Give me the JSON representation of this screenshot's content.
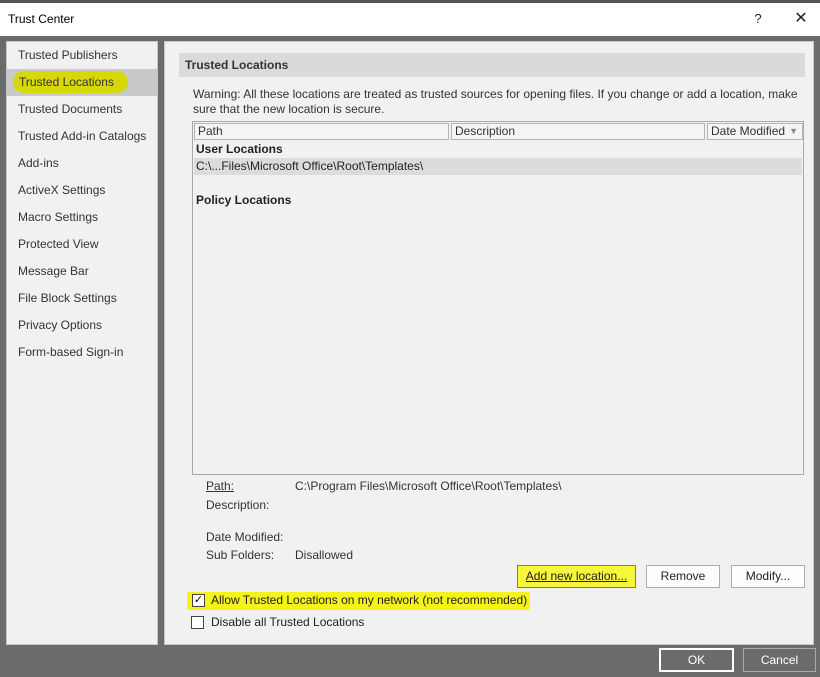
{
  "window": {
    "title": "Trust Center",
    "help_glyph": "?",
    "close_glyph": "✕"
  },
  "sidebar": {
    "items": [
      {
        "label": "Trusted Publishers"
      },
      {
        "label": "Trusted Locations"
      },
      {
        "label": "Trusted Documents"
      },
      {
        "label": "Trusted Add-in Catalogs"
      },
      {
        "label": "Add-ins"
      },
      {
        "label": "ActiveX Settings"
      },
      {
        "label": "Macro Settings"
      },
      {
        "label": "Protected View"
      },
      {
        "label": "Message Bar"
      },
      {
        "label": "File Block Settings"
      },
      {
        "label": "Privacy Options"
      },
      {
        "label": "Form-based Sign-in"
      }
    ],
    "selected_label": "Trusted Locations"
  },
  "main": {
    "section_title": "Trusted Locations",
    "warning": "Warning: All these locations are treated as trusted sources for opening files.  If you change or add a location, make sure that the new location is secure.",
    "list": {
      "columns": [
        "Path",
        "Description",
        "Date Modified"
      ],
      "user_locations_label": "User Locations",
      "rows": [
        {
          "path": "C:\\...Files\\Microsoft Office\\Root\\Templates\\"
        }
      ],
      "policy_locations_label": "Policy Locations"
    },
    "details": {
      "path_label": "Path:",
      "path_value": "C:\\Program Files\\Microsoft Office\\Root\\Templates\\",
      "description_label": "Description:",
      "date_modified_label": "Date Modified:",
      "sub_folders_label": "Sub Folders:",
      "sub_folders_value": "Disallowed"
    },
    "buttons": {
      "add": "Add new location...",
      "remove": "Remove",
      "modify": "Modify..."
    },
    "checkboxes": {
      "allow_network": {
        "label": "Allow Trusted Locations on my network (not recommended)",
        "checked": true
      },
      "disable_all": {
        "label": "Disable all Trusted Locations",
        "checked": false
      }
    }
  },
  "footer": {
    "ok": "OK",
    "cancel": "Cancel"
  },
  "colors": {
    "highlight": "#f4f41a",
    "selection": "#c9c9c9",
    "dialog_bg": "#f1f1f1",
    "frame": "#6b6b6b"
  }
}
